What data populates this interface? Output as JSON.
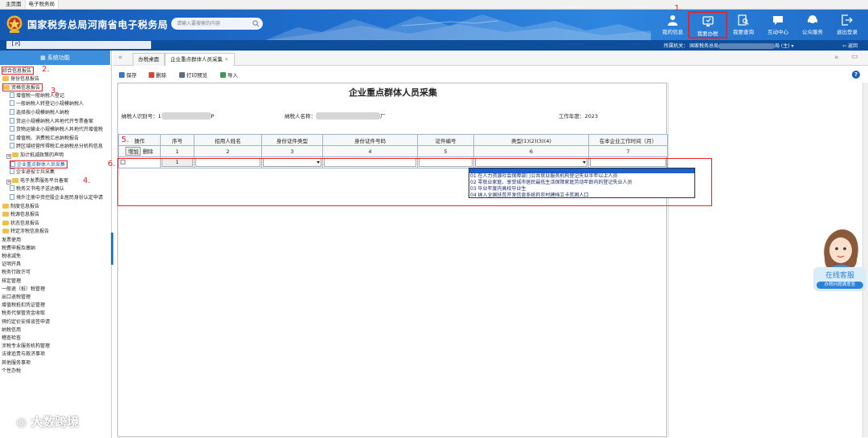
{
  "browser_tabs": [
    "主页面",
    "电子税务局"
  ],
  "header": {
    "title": "国家税务总局河南省电子税务局",
    "search_placeholder": "请输入要搜索的内容",
    "nav": [
      {
        "label": "我的信息",
        "icon": "user-icon"
      },
      {
        "label": "我要办税",
        "icon": "monitor-icon",
        "selected": true
      },
      {
        "label": "我要查询",
        "icon": "doc-search-icon"
      },
      {
        "label": "互动中心",
        "icon": "chat-icon"
      },
      {
        "label": "公众服务",
        "icon": "service-icon"
      },
      {
        "label": "退出登录",
        "icon": "logout-icon"
      }
    ]
  },
  "bar": {
    "taxpayer": "【                                                  P】",
    "region_label": "所属机关：",
    "region_value": "国家税务总局",
    "region_suffix": "局 (主)",
    "return": "返回"
  },
  "annotations": [
    "1.",
    "2.",
    "3.",
    "4.",
    "5.",
    "6."
  ],
  "sidebar": {
    "header": "系统功能",
    "items": [
      {
        "label": "综合信息报告",
        "type": "plain"
      },
      {
        "label": "身份信息报告",
        "type": "folder"
      },
      {
        "label": "资格信息报告",
        "type": "folder"
      },
      {
        "label": "增值税一般纳税人登记",
        "type": "doc"
      },
      {
        "label": "一般纳税人转登记小规模纳税人",
        "type": "doc"
      },
      {
        "label": "选择按小规模纳税人纳税",
        "type": "doc"
      },
      {
        "label": "货运小规模纳税人异地代开专票备案",
        "type": "doc"
      },
      {
        "label": "货物运输业小规模纳税人异地代开增值税",
        "type": "doc"
      },
      {
        "label": "增值税、消费税汇总纳税报告",
        "type": "doc"
      },
      {
        "label": "跨区域经营所得税汇总纳税总分机构信息",
        "type": "doc"
      },
      {
        "label": "加计抵减政策的声明",
        "type": "plusfolder"
      },
      {
        "label": "企业重点群体人员采集",
        "type": "doc"
      },
      {
        "label": "企业退役士兵采集",
        "type": "doc"
      },
      {
        "label": "电子发票服务平台备案",
        "type": "plusfolder"
      },
      {
        "label": "税务文书电子送达确认",
        "type": "doc"
      },
      {
        "label": "境外注册中资控股企业居民身份认定申请",
        "type": "doc"
      },
      {
        "label": "制度信息报告",
        "type": "folder"
      },
      {
        "label": "税源信息报告",
        "type": "folder"
      },
      {
        "label": "状态信息报告",
        "type": "folder"
      },
      {
        "label": "特定涉税信息报告",
        "type": "folder"
      },
      {
        "label": "发票使用",
        "type": "plain"
      },
      {
        "label": "税费申报及缴纳",
        "type": "plain"
      },
      {
        "label": "税收减免",
        "type": "plain"
      },
      {
        "label": "证明开具",
        "type": "plain"
      },
      {
        "label": "税务行政许可",
        "type": "plain"
      },
      {
        "label": "核定管理",
        "type": "plain"
      },
      {
        "label": "一般退（抵）税管理",
        "type": "plain"
      },
      {
        "label": "出口退税管理",
        "type": "plain"
      },
      {
        "label": "增值税抵扣凭证管理",
        "type": "plain"
      },
      {
        "label": "税务代保管资金收取",
        "type": "plain"
      },
      {
        "label": "预约定价安排谈签申请",
        "type": "plain"
      },
      {
        "label": "纳税信用",
        "type": "plain"
      },
      {
        "label": "稽查检查",
        "type": "plain"
      },
      {
        "label": "涉税专业服务机构管理",
        "type": "plain"
      },
      {
        "label": "法律追责与救济事项",
        "type": "plain"
      },
      {
        "label": "其他服务事项",
        "type": "plain"
      },
      {
        "label": "个性办税",
        "type": "plain"
      }
    ]
  },
  "tabs": [
    "办税桌面",
    "企业重点群体人员采集"
  ],
  "toolbar": {
    "save": "保存",
    "delete": "删除",
    "print": "打印预览",
    "import": "导入"
  },
  "form": {
    "title": "企业重点群体人员采集",
    "taxpayer_id_label": "纳税人识别号：",
    "taxpayer_id_prefix": "1",
    "taxpayer_id_suffix": "P",
    "taxpayer_name_label": "纳税人名称：",
    "taxpayer_name_suffix": "厂",
    "year_label": "工作年度：",
    "year_value": "2023",
    "columns": [
      "操作",
      "序号",
      "招用人姓名",
      "身份证件类型",
      "身份证件号码",
      "证件编号",
      "类型(1)(2)(3)(4)",
      "在本企业工作时间（月）"
    ],
    "column_numbers": [
      "",
      "1",
      "2",
      "3",
      "4",
      "5",
      "6",
      "7"
    ],
    "add_button": "增加",
    "delete_button": "删除",
    "row_index": "1",
    "dropdown_options": [
      "01 在人力资源社会保障部门公共就业服务机构登记失业半年以上人员",
      "02 零就业家庭、享受城市居民最低生活保障家庭劳动年龄内的登记失业人员",
      "03 毕业年度内高校毕业生",
      "04 纳入全国扶贫开发信息系统的农村建档立卡贫困人口"
    ]
  },
  "service": {
    "title": "在线客服",
    "subtitle": "办税问题满意答"
  },
  "watermark": "大数跨境"
}
